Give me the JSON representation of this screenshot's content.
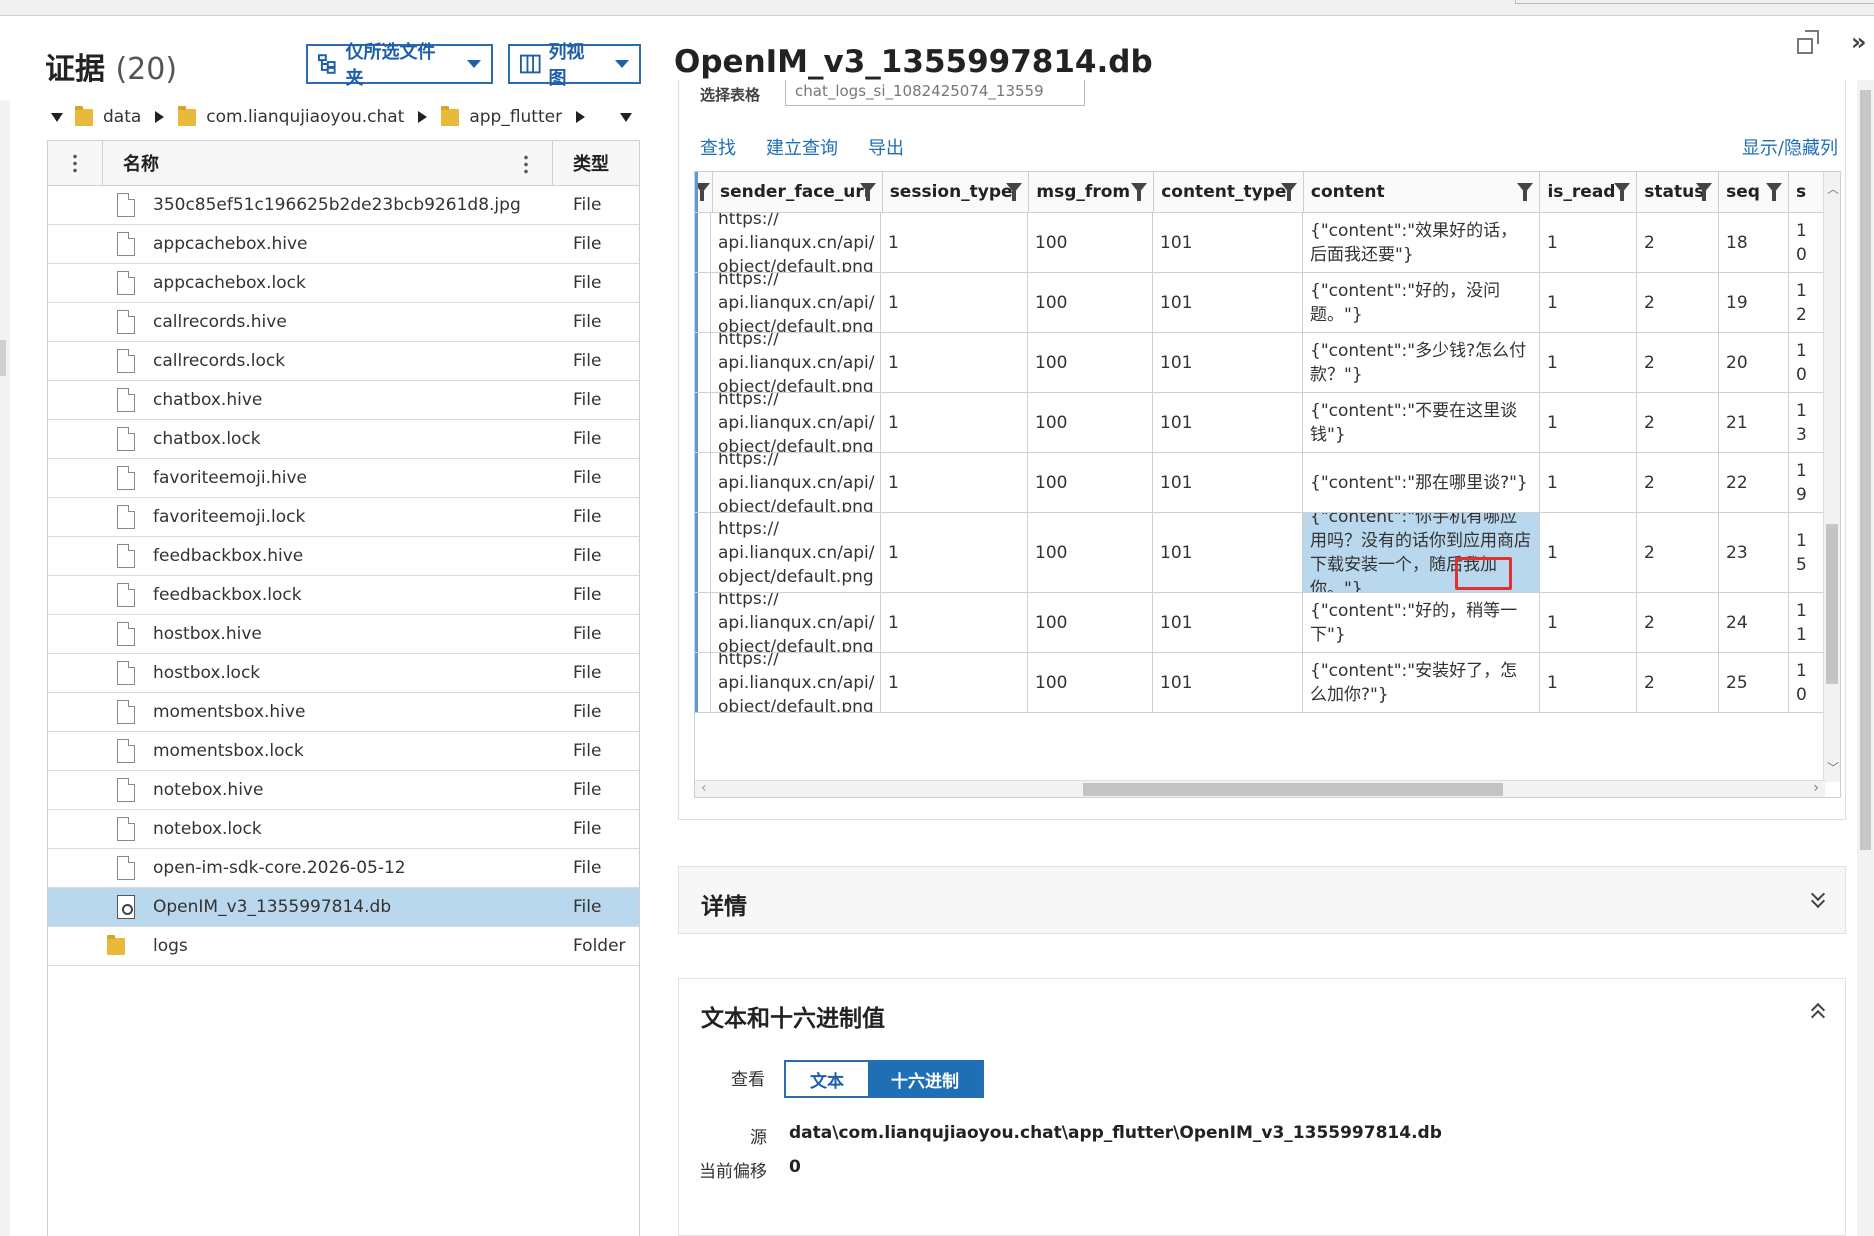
{
  "left_panel": {
    "title": "证据",
    "count": "(20)",
    "folder_filter_label": "仅所选文件夹",
    "view_label": "列视图",
    "breadcrumb": [
      "data",
      "com.lianqujiaoyou.chat",
      "app_flutter"
    ],
    "columns": {
      "name": "名称",
      "type": "类型"
    },
    "files": [
      {
        "name": "350c85ef51c196625b2de23bcb9261d8.jpg",
        "type": "File",
        "icon": "file-icon"
      },
      {
        "name": "appcachebox.hive",
        "type": "File",
        "icon": "file-icon"
      },
      {
        "name": "appcachebox.lock",
        "type": "File",
        "icon": "file-icon"
      },
      {
        "name": "callrecords.hive",
        "type": "File",
        "icon": "file-icon"
      },
      {
        "name": "callrecords.lock",
        "type": "File",
        "icon": "file-icon"
      },
      {
        "name": "chatbox.hive",
        "type": "File",
        "icon": "file-icon"
      },
      {
        "name": "chatbox.lock",
        "type": "File",
        "icon": "file-icon"
      },
      {
        "name": "favoriteemoji.hive",
        "type": "File",
        "icon": "file-icon"
      },
      {
        "name": "favoriteemoji.lock",
        "type": "File",
        "icon": "file-icon"
      },
      {
        "name": "feedbackbox.hive",
        "type": "File",
        "icon": "file-icon"
      },
      {
        "name": "feedbackbox.lock",
        "type": "File",
        "icon": "file-icon"
      },
      {
        "name": "hostbox.hive",
        "type": "File",
        "icon": "file-icon"
      },
      {
        "name": "hostbox.lock",
        "type": "File",
        "icon": "file-icon"
      },
      {
        "name": "momentsbox.hive",
        "type": "File",
        "icon": "file-icon"
      },
      {
        "name": "momentsbox.lock",
        "type": "File",
        "icon": "file-icon"
      },
      {
        "name": "notebox.hive",
        "type": "File",
        "icon": "file-icon"
      },
      {
        "name": "notebox.lock",
        "type": "File",
        "icon": "file-icon"
      },
      {
        "name": "open-im-sdk-core.2026-05-12",
        "type": "File",
        "icon": "file-icon"
      },
      {
        "name": "OpenIM_v3_1355997814.db",
        "type": "File",
        "icon": "database-icon",
        "selected": true
      },
      {
        "name": "logs",
        "type": "Folder",
        "icon": "folder-icon"
      }
    ]
  },
  "right_panel": {
    "title": "OpenIM_v3_1355997814.db",
    "select_table_label": "选择表格",
    "select_table_value": "chat_logs_si_1082425074_13559",
    "actions": [
      "查找",
      "建立查询",
      "导出"
    ],
    "toggle_columns": "显示/隐藏列",
    "columns": [
      "sender_face_url",
      "session_type",
      "msg_from",
      "content_type",
      "content",
      "is_read",
      "status",
      "seq",
      "s"
    ],
    "rows": [
      {
        "url": [
          "https://",
          "api.lianqux.cn/api/",
          "object/default.png"
        ],
        "session_type": "1",
        "msg_from": "100",
        "content_type": "101",
        "content": "{\"content\":\"效果好的话，后面我还要\"}",
        "is_read": "1",
        "status": "2",
        "seq": "18",
        "s": "1 0",
        "h": 60
      },
      {
        "url": [
          "https://",
          "api.lianqux.cn/api/",
          "object/default.png"
        ],
        "session_type": "1",
        "msg_from": "100",
        "content_type": "101",
        "content": "{\"content\":\"好的，没问题。\"}",
        "is_read": "1",
        "status": "2",
        "seq": "19",
        "s": "1 2",
        "h": 60
      },
      {
        "url": [
          "https://",
          "api.lianqux.cn/api/",
          "object/default.png"
        ],
        "session_type": "1",
        "msg_from": "100",
        "content_type": "101",
        "content": "{\"content\":\"多少钱?怎么付款？\"}",
        "is_read": "1",
        "status": "2",
        "seq": "20",
        "s": "1 0",
        "h": 60
      },
      {
        "url": [
          "https://",
          "api.lianqux.cn/api/",
          "object/default.png"
        ],
        "session_type": "1",
        "msg_from": "100",
        "content_type": "101",
        "content": "{\"content\":\"不要在这里谈钱\"}",
        "is_read": "1",
        "status": "2",
        "seq": "21",
        "s": "1 3",
        "h": 60
      },
      {
        "url": [
          "https://",
          "api.lianqux.cn/api/",
          "object/default.png"
        ],
        "session_type": "1",
        "msg_from": "100",
        "content_type": "101",
        "content": "{\"content\":\"那在哪里谈?\"}",
        "is_read": "1",
        "status": "2",
        "seq": "22",
        "s": "1 9",
        "h": 60
      },
      {
        "url": [
          "https://",
          "api.lianqux.cn/api/",
          "object/default.png"
        ],
        "session_type": "1",
        "msg_from": "100",
        "content_type": "101",
        "content": "{\"content\":\"你手机有哪应用吗？没有的话你到应用商店下载安装一个，随后我加你。\"}",
        "is_read": "1",
        "status": "2",
        "seq": "23",
        "s": "1 5",
        "h": 80,
        "highlight": true
      },
      {
        "url": [
          "https://",
          "api.lianqux.cn/api/",
          "object/default.png"
        ],
        "session_type": "1",
        "msg_from": "100",
        "content_type": "101",
        "content": "{\"content\":\"好的，稍等一下\"}",
        "is_read": "1",
        "status": "2",
        "seq": "24",
        "s": "1 1",
        "h": 60
      },
      {
        "url": [
          "https://",
          "api.lianqux.cn/api/",
          "object/default.png"
        ],
        "session_type": "1",
        "msg_from": "100",
        "content_type": "101",
        "content": "{\"content\":\"安装好了，怎么加你?\"}",
        "is_read": "1",
        "status": "2",
        "seq": "25",
        "s": "1 0",
        "h": 60
      }
    ]
  },
  "details": {
    "title": "详情"
  },
  "hex_section": {
    "title": "文本和十六进制值",
    "view_label": "查看",
    "text_tab": "文本",
    "hex_tab": "十六进制",
    "source_label": "源",
    "source_value": "data\\com.lianqujiaoyou.chat\\app_flutter\\OpenIM_v3_1355997814.db",
    "offset_label": "当前偏移",
    "offset_value": "0"
  }
}
